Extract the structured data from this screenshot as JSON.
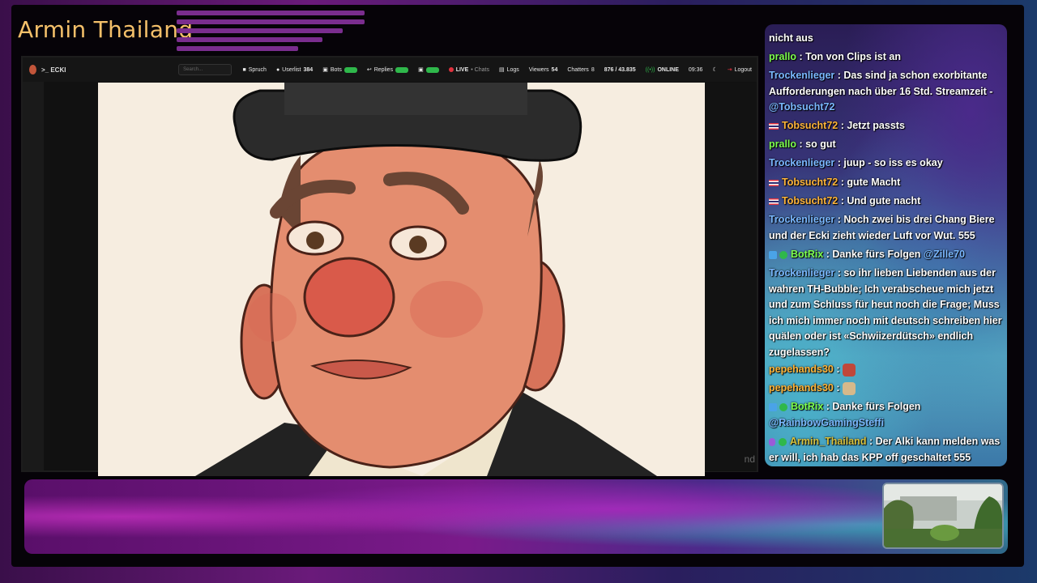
{
  "stream": {
    "title": "Armin Thailand"
  },
  "topbar": {
    "brand": ">_ ECKI",
    "search_placeholder": "Search...",
    "items": {
      "spruch": "Spruch",
      "userlist_label": "Userlist",
      "userlist_count": "384",
      "bots": "Bots",
      "replies": "Replies",
      "live": "LIVE",
      "chats": "• Chats",
      "logs": "Logs",
      "viewers_label": "Viewers",
      "viewers_count": "54",
      "chatters_label": "Chatters",
      "chatters_count": "8",
      "followers": "876 / 43.835",
      "online": "ONLINE",
      "time": "09:36",
      "logout": "Logout"
    },
    "colors": {
      "pill": "#2fb84b",
      "live": "#e0323e",
      "online": "#2fb84b"
    }
  },
  "capture": {
    "right_strip_text": "nd"
  },
  "chat": {
    "messages": [
      {
        "user": "",
        "text": "nicht aus"
      },
      {
        "user": "prallo",
        "sep": " : ",
        "text": "Ton von Clips ist an"
      },
      {
        "user": "Trockenlieger",
        "sep": " : ",
        "text": "Das sind ja schon exorbitante Aufforderungen nach über 16 Std. Streamzeit - ",
        "mention": "@Tobsucht72"
      },
      {
        "user": "Tobsucht72",
        "sep": " : ",
        "text": "Jetzt passts"
      },
      {
        "user": "prallo",
        "sep": " : ",
        "text": "so gut"
      },
      {
        "user": "Trockenlieger",
        "sep": " : ",
        "text": "juup - so iss es okay"
      },
      {
        "user": "Tobsucht72",
        "sep": " : ",
        "text": "gute Macht"
      },
      {
        "user": "Tobsucht72",
        "sep": " : ",
        "text": "Und gute nacht"
      },
      {
        "user": "Trockenlieger",
        "sep": " : ",
        "text": "Noch zwei bis drei Chang Biere und der Ecki zieht wieder Luft vor Wut. 555"
      },
      {
        "user": "BotRix",
        "sep": " : ",
        "text": "Danke fürs Folgen ",
        "mention": "@Zille70"
      },
      {
        "user": "Trockenlieger",
        "sep": " : ",
        "text": "so ihr lieben Liebenden aus der wahren TH-Bubble; Ich verabscheue mich jetzt und zum Schluss für heut noch die Frage; Muss ich mich immer noch mit deutsch schreiben hier quälen oder ist «Schwiizerdütsch» endlich zugelassen?"
      },
      {
        "user": "pepehands30",
        "sep": " : ",
        "text": ""
      },
      {
        "user": "pepehands30",
        "sep": " : ",
        "text": ""
      },
      {
        "user": "BotRix",
        "sep": " : ",
        "text": "Danke fürs Folgen ",
        "mention": "@RainbowGamingSteffi"
      },
      {
        "user": "Armin_Thailand",
        "sep": " : ",
        "text": "Der Alki kann melden was er will, ich hab das KPP off geschaltet 555"
      }
    ],
    "colors": {
      "prallo": "#7dff4f",
      "Trockenlieger": "#7ab8ff",
      "Tobsucht72": "#ffb53a",
      "BotRix": "#7dff4f",
      "Armin_Thailand": "#d8c23e",
      "pepehands30": "#ffb53a"
    }
  },
  "icons": [
    "flag-icon",
    "bot-icon",
    "verified-icon",
    "mic-icon",
    "emote-icon"
  ]
}
